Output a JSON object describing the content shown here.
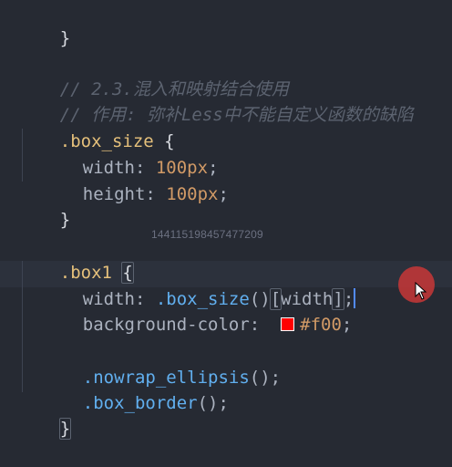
{
  "editor": {
    "lines": {
      "l0": "}",
      "l1": "// 2.3.混入和映射结合使用",
      "l2": "// 作用: 弥补Less中不能自定义函数的缺陷",
      "l3_selector": ".box_size",
      "l3_brace": " {",
      "l4_prop": "width",
      "l4_colon": ": ",
      "l4_val": "100px",
      "l4_semi": ";",
      "l5_prop": "height",
      "l5_colon": ": ",
      "l5_val": "100px",
      "l5_semi": ";",
      "l6": "}",
      "l8_selector": ".box1",
      "l8_space": " ",
      "l8_brace": "{",
      "l9_prop": "width",
      "l9_colon": ": ",
      "l9_mixin": ".box_size",
      "l9_parens": "()",
      "l9_lbr": "[",
      "l9_key": "width",
      "l9_rbr": "]",
      "l9_semi": ";",
      "l10_prop": "background-color",
      "l10_colon": ":  ",
      "l10_val": "#f00",
      "l10_semi": ";",
      "l12_mixin": ".nowrap_ellipsis",
      "l12_rest": "();",
      "l13_mixin": ".box_border",
      "l13_rest": "();",
      "l14": "}"
    },
    "swatch_color": "#ff0000"
  },
  "watermark": "144115198457477209",
  "colors": {
    "background": "#262a33",
    "comment": "#5c6370",
    "selector": "#e5c07b",
    "number": "#d19a66",
    "mixin": "#61afef",
    "cursor": "#528bff",
    "pointer_highlight": "#c83737"
  }
}
